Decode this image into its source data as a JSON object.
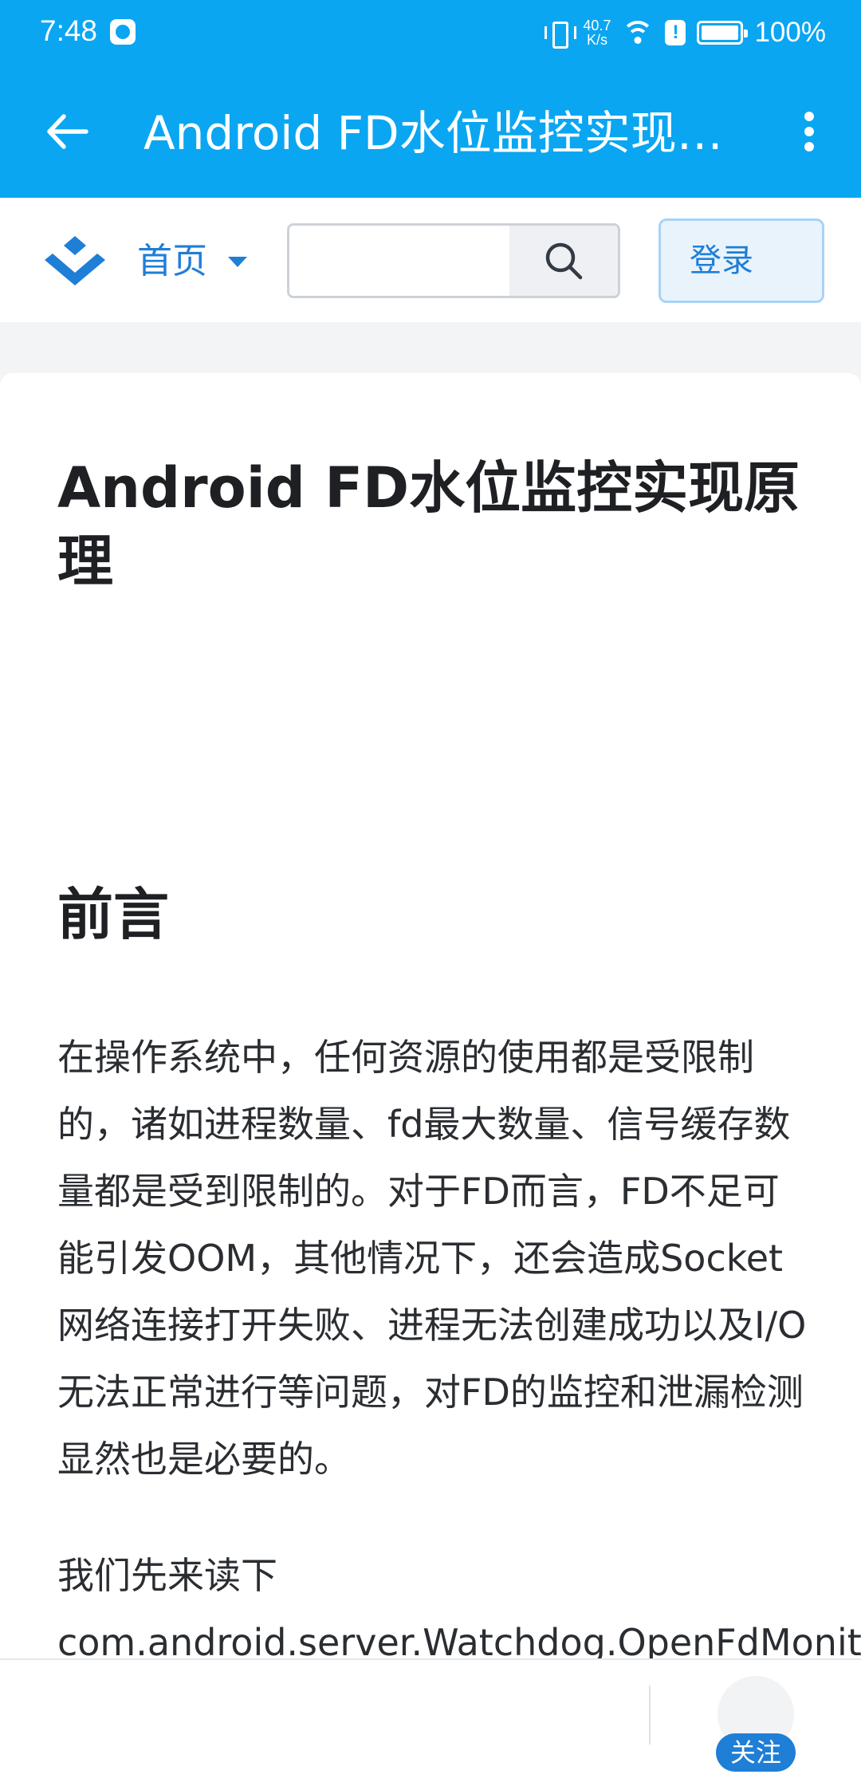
{
  "status_bar": {
    "time": "7:48",
    "net_speed_value": "40.7",
    "net_speed_unit": "K/s",
    "alert": "!",
    "battery": "100%"
  },
  "app_bar": {
    "title": "Android FD水位监控实现原理",
    "icons": [
      "arrow-left-icon",
      "more-vertical-icon"
    ]
  },
  "site_nav": {
    "home_label": "首页",
    "search_placeholder": "",
    "login_label": "登录"
  },
  "article": {
    "title": "Android FD水位监控实现原理",
    "section_title": "前言",
    "paragraph1": "在操作系统中，任何资源的使用都是受限制的，诸如进程数量、fd最大数量、信号缓存数量都是受到限制的。对于FD而言，FD不足可能引发OOM，其他情况下，还会造成Socket网络连接打开失败、进程无法创建成功以及I/O无法正常进行等问题，对FD的监控和泄漏检测显然也是必要的。",
    "paragraph2": "我们先来读下com.android.server.Watchdog.OpenFdMonitor"
  },
  "bottom_bar": {
    "follow_label": "关注"
  },
  "colors": {
    "primary": "#0aa6f2",
    "link": "#1f7ed6"
  }
}
